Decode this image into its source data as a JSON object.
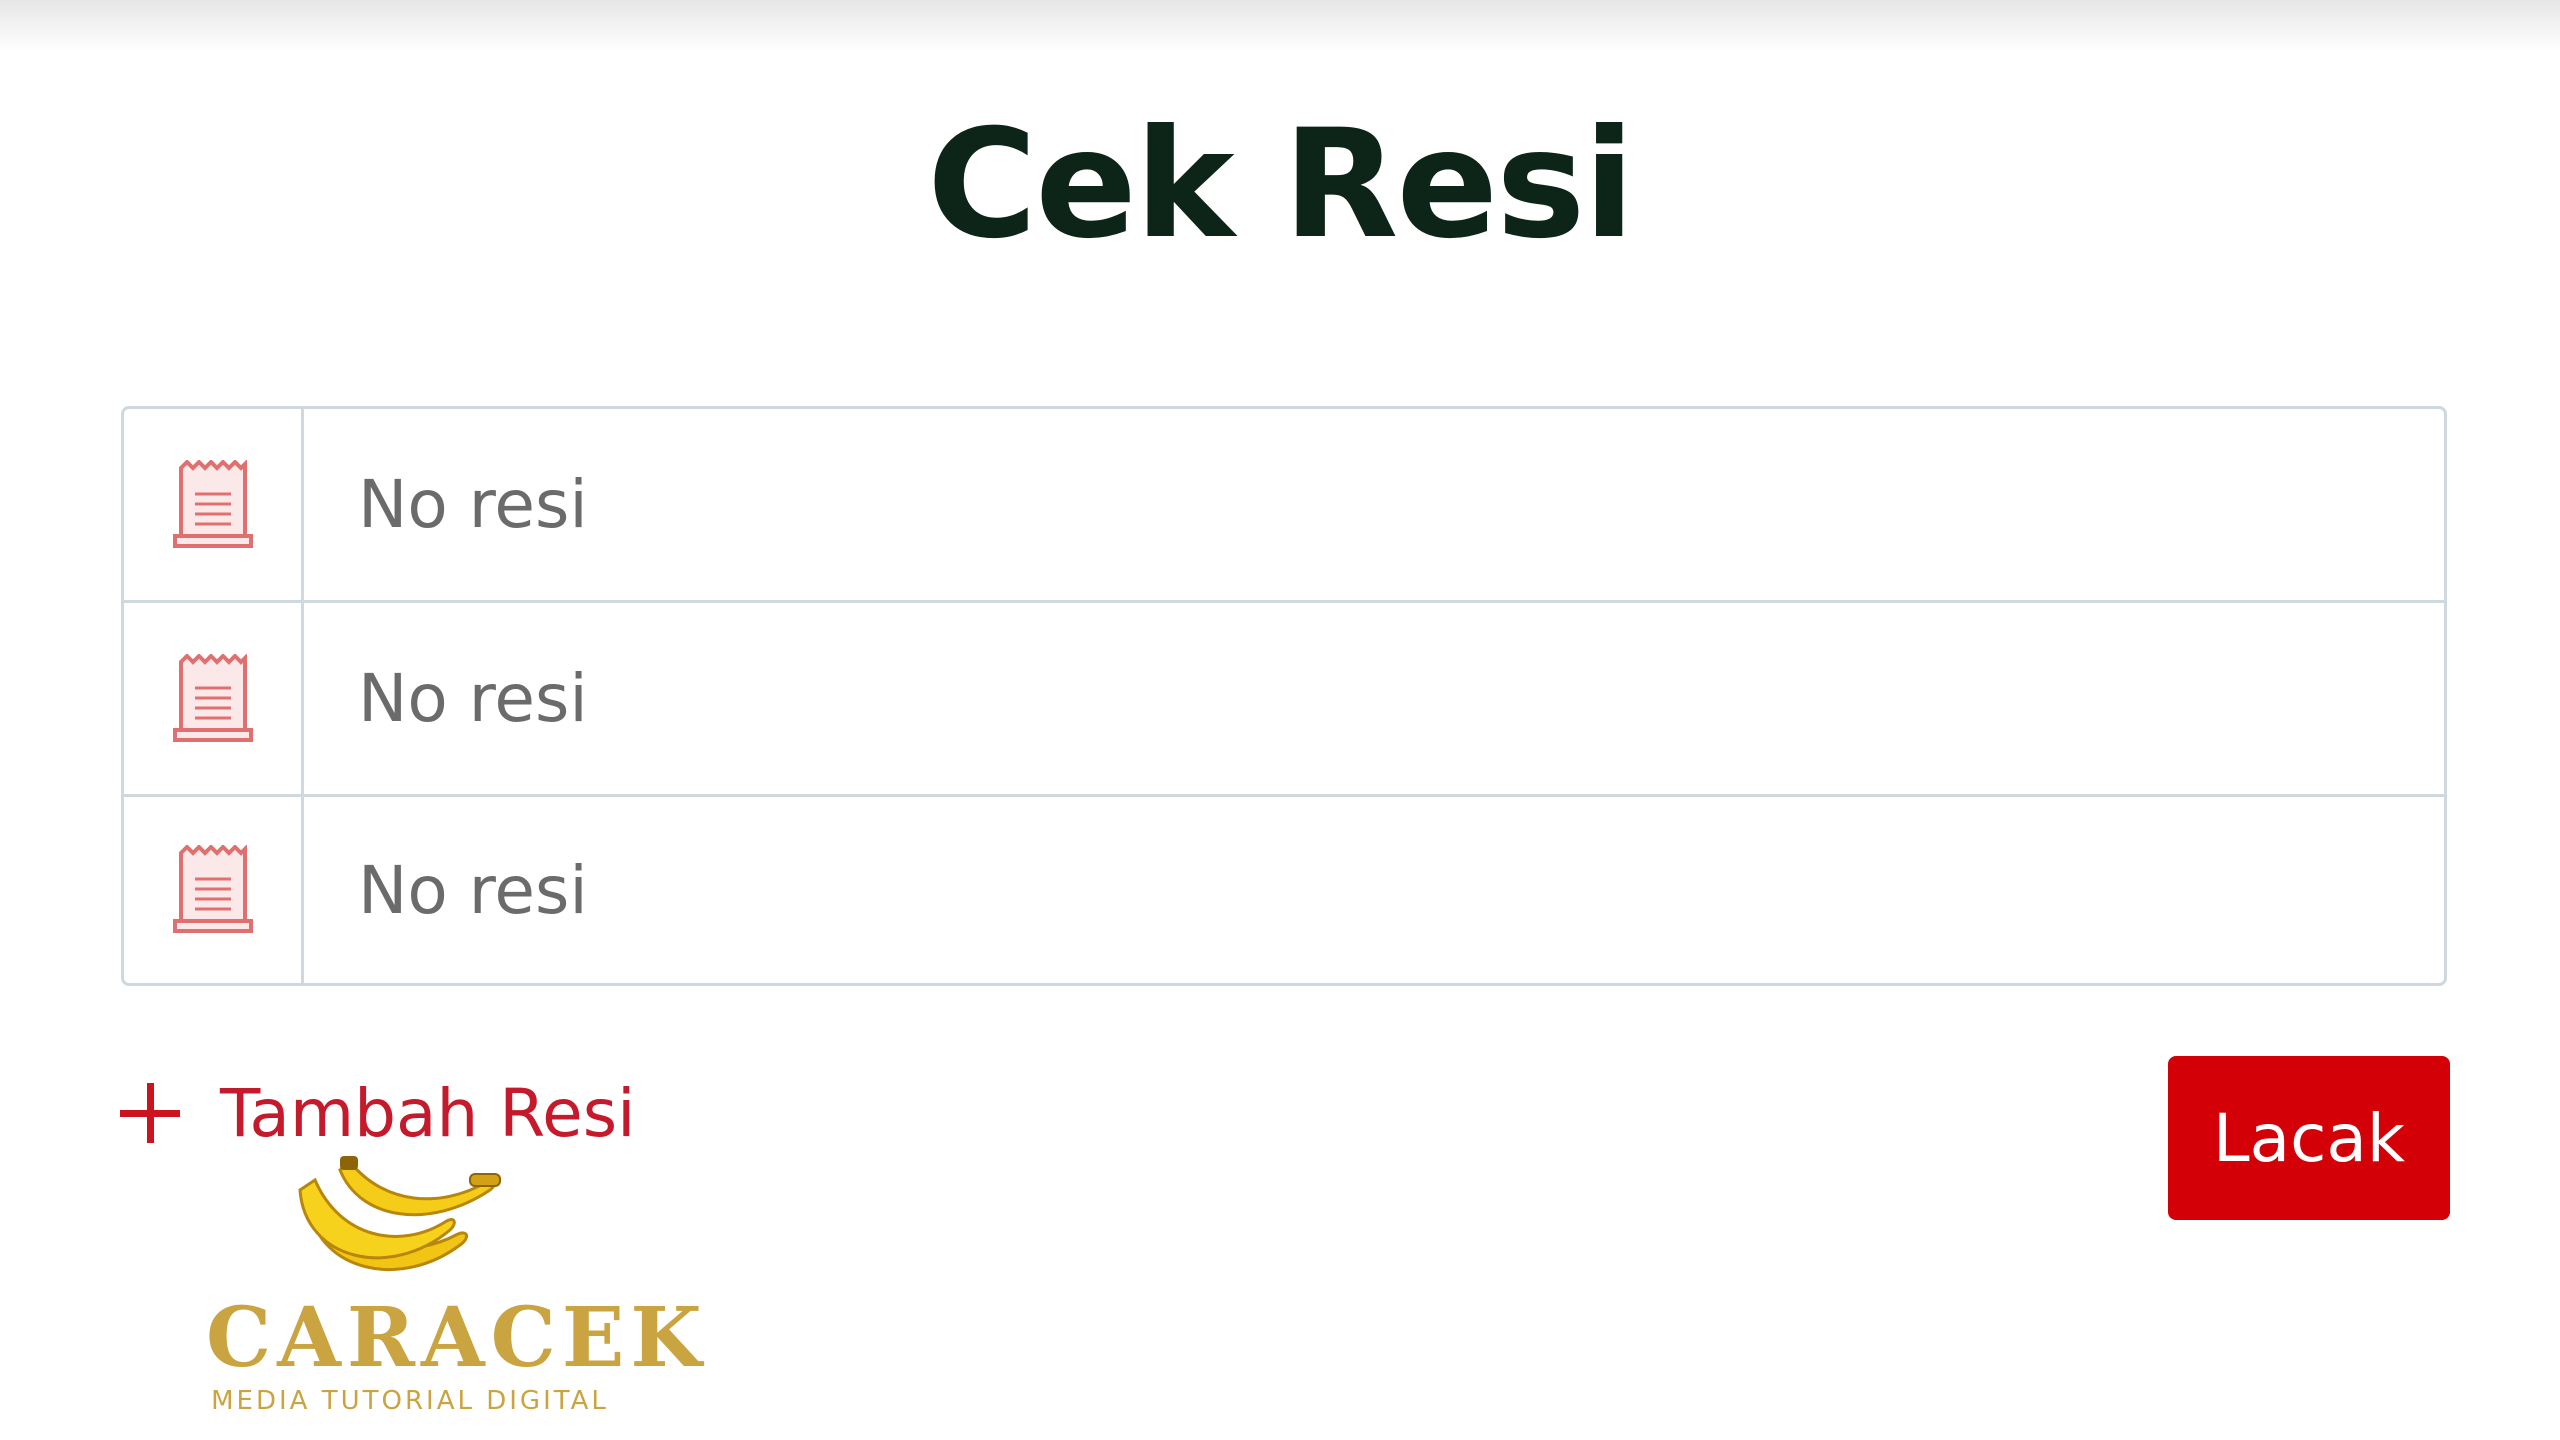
{
  "page": {
    "title": "Cek Resi"
  },
  "form": {
    "rows": [
      {
        "placeholder": "No resi",
        "icon": "receipt-icon"
      },
      {
        "placeholder": "No resi",
        "icon": "receipt-icon"
      },
      {
        "placeholder": "No resi",
        "icon": "receipt-icon"
      }
    ],
    "add_label": "Tambah Resi",
    "add_icon": "plus-icon",
    "submit_label": "Lacak"
  },
  "watermark": {
    "name": "CARACEK",
    "tagline": "MEDIA TUTORIAL DIGITAL",
    "icon": "banana-logo-icon"
  },
  "colors": {
    "accent_red": "#d30008",
    "link_red": "#c41a2b",
    "icon_red": "#e07070",
    "title": "#0c2518",
    "border": "#cfd8dc",
    "watermark_gold": "#c9a441"
  }
}
